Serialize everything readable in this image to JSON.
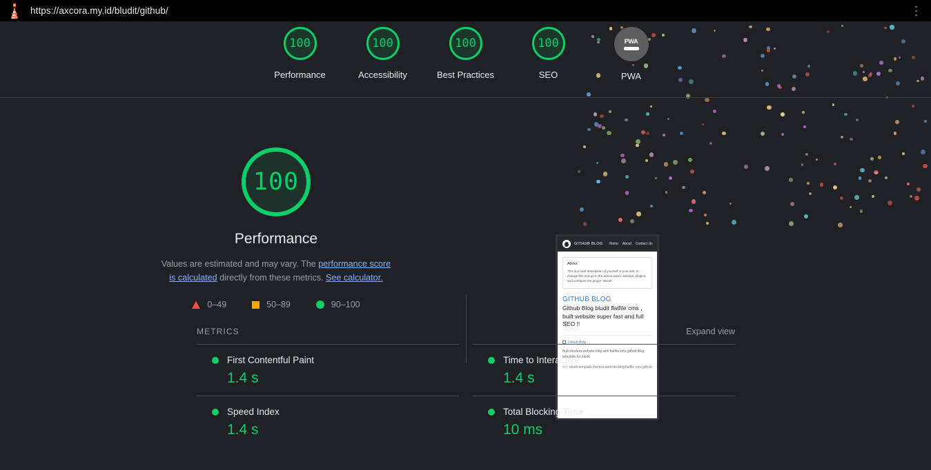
{
  "browser": {
    "url": "https://axcora.my.id/bludit/github/",
    "lighthouse_icon": "lighthouse-icon",
    "menu_icon": "kebab-menu-icon"
  },
  "scores_header": {
    "items": [
      {
        "label": "Performance",
        "score": "100",
        "type": "gauge"
      },
      {
        "label": "Accessibility",
        "score": "100",
        "type": "gauge"
      },
      {
        "label": "Best Practices",
        "score": "100",
        "type": "gauge"
      },
      {
        "label": "SEO",
        "score": "100",
        "type": "gauge"
      },
      {
        "label": "PWA",
        "score": "PWA",
        "type": "badge"
      }
    ]
  },
  "category": {
    "score": "100",
    "title": "Performance",
    "description_part1": "Values are estimated and may vary. The ",
    "link1": "performance score is calculated",
    "description_part2": " directly from these metrics. ",
    "link2": "See calculator.",
    "legend": [
      {
        "range": "0–49",
        "shape": "triangle",
        "color": "#ff4e42"
      },
      {
        "range": "50–89",
        "shape": "square",
        "color": "#ffa400"
      },
      {
        "range": "90–100",
        "shape": "circle",
        "color": "#0cce6b"
      }
    ]
  },
  "thumbnail": {
    "brand": "GITHUB BLOG",
    "nav": [
      "Home",
      "About",
      "Contact Us"
    ],
    "about_heading": "About",
    "about_text": "This is a brief description of yourself or your site, to change this text go to the admin panel, settings, plugins, and configure the plugin \"about\".",
    "heading": "GITHUB BLOG",
    "subheading": "Github Blog bludit flatfile cms , built website super fast and full SEO !!",
    "meta_label": "Github Blog",
    "meta_desc": "Built modern website blog with flatfile cms github blog template for bludit",
    "code_icon": "</>",
    "code_text": "bludit,template,themes,website,blog,flatfile cms,github"
  },
  "metrics": {
    "title": "METRICS",
    "expand_label": "Expand view",
    "items": [
      {
        "label": "First Contentful Paint",
        "value": "1.4 s",
        "status": "pass"
      },
      {
        "label": "Time to Interactive",
        "value": "1.4 s",
        "status": "pass"
      },
      {
        "label": "Speed Index",
        "value": "1.4 s",
        "status": "pass"
      },
      {
        "label": "Total Blocking Time",
        "value": "10 ms",
        "status": "pass"
      }
    ]
  },
  "colors": {
    "pass": "#0cce6b",
    "average": "#ffa400",
    "fail": "#ff4e42",
    "link": "#8ab4f8",
    "background": "#202124",
    "text": "#e8eaed",
    "muted": "#9aa0a6"
  }
}
